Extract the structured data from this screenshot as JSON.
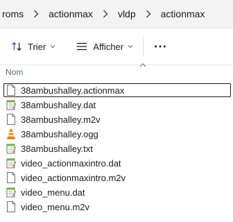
{
  "breadcrumb": {
    "items": [
      "roms",
      "actionmax",
      "vldp",
      "actionmax"
    ]
  },
  "toolbar": {
    "sort_label": "Trier",
    "view_label": "Afficher",
    "more_label": "•••"
  },
  "columns": {
    "name": "Nom"
  },
  "files": [
    {
      "name": "38ambushalley.actionmax",
      "icon": "blank-file-icon"
    },
    {
      "name": "38ambushalley.dat",
      "icon": "notepad-file-icon"
    },
    {
      "name": "38ambushalley.m2v",
      "icon": "blank-file-icon"
    },
    {
      "name": "38ambushalley.ogg",
      "icon": "vlc-cone-icon"
    },
    {
      "name": "38ambushalley.txt",
      "icon": "notepad-file-icon"
    },
    {
      "name": "video_actionmaxintro.dat",
      "icon": "notepad-file-icon"
    },
    {
      "name": "video_actionmaxintro.m2v",
      "icon": "blank-file-icon"
    },
    {
      "name": "video_menu.dat",
      "icon": "notepad-file-icon"
    },
    {
      "name": "video_menu.m2v",
      "icon": "blank-file-icon"
    }
  ],
  "colors": {
    "accent": "#0067c0",
    "notepad_green": "#6bbf3a",
    "vlc_orange": "#f08a00"
  }
}
